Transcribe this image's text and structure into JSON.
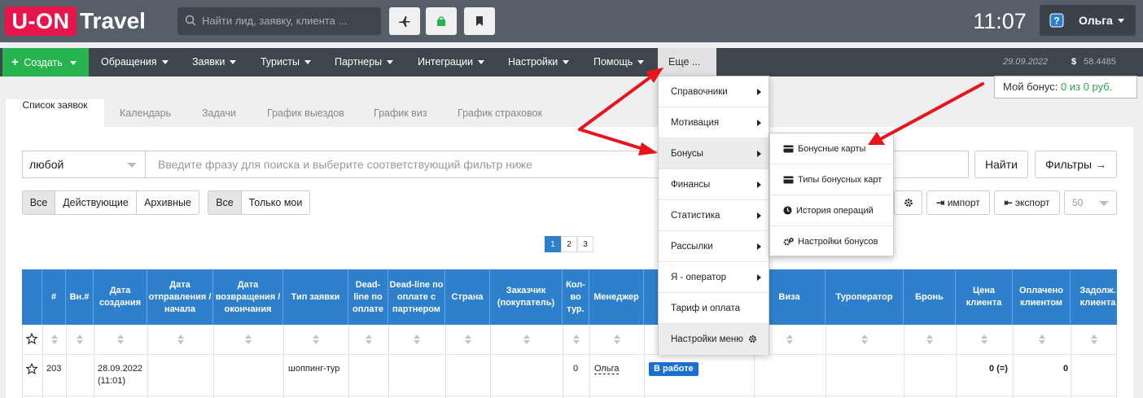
{
  "header": {
    "logo_box": "U-ON",
    "logo_text": "Travel",
    "search_placeholder": "Найти лид, заявку, клиента ...",
    "clock": "11:07",
    "user": "Ольга"
  },
  "nav": {
    "create": "Создать",
    "items": [
      "Обращения",
      "Заявки",
      "Туристы",
      "Партнеры",
      "Интеграции",
      "Настройки",
      "Помощь"
    ],
    "more": "Еще ...",
    "date": "29.09.2022",
    "currency": "$",
    "rate": "58.4485"
  },
  "bonus": {
    "label": "Мой бонус: ",
    "value": "0 из 0 руб."
  },
  "tabs": [
    "Список заявок",
    "Календарь",
    "Задачи",
    "График выездов",
    "График виз",
    "График страховок"
  ],
  "filter": {
    "select": "любой",
    "placeholder": "Введите фразу для поиска и выберите соответствующий фильтр ниже",
    "find": "Найти",
    "filters": "Фильтры →"
  },
  "segments": {
    "group1": [
      "Все",
      "Действующие",
      "Архивные"
    ],
    "group2": [
      "Все",
      "Только мои"
    ]
  },
  "tools": {
    "import": "импорт",
    "export": "экспорт",
    "per_page": "50"
  },
  "pagination": [
    "1",
    "2",
    "3"
  ],
  "dropdown": [
    "Справочники",
    "Мотивация",
    "Бонусы",
    "Финансы",
    "Статистика",
    "Рассылки",
    "Я - оператор",
    "Тариф и оплата",
    "Настройки меню"
  ],
  "submenu": [
    "Бонусные карты",
    "Типы бонусных карт",
    "История операций",
    "Настройки бонусов"
  ],
  "table": {
    "headers": [
      "#",
      "Вн.#",
      "Дата создания",
      "Дата отправления / начала",
      "Дата возвращения / окончания",
      "Тип заявки",
      "Dead-line по оплате",
      "Dead-line по оплате с партнером",
      "Страна",
      "Заказчик (покупатель)",
      "Кол-во тур.",
      "Менеджер",
      "Виза",
      "Туроператор",
      "Бронь",
      "Цена клиента",
      "Оплачено клиентом",
      "Задолж. клиента"
    ],
    "row": {
      "id": "203",
      "date": "28.09.2022",
      "time": "(11:01)",
      "type": "шоппинг-тур",
      "count": "0",
      "manager": "Ольга",
      "status": "В работе",
      "price": "0 (=)",
      "paid": "0"
    }
  },
  "colors": {
    "accent": "#2f80cc",
    "create": "#27b34f",
    "logo": "#e8154c",
    "arrow": "#e8151c"
  }
}
